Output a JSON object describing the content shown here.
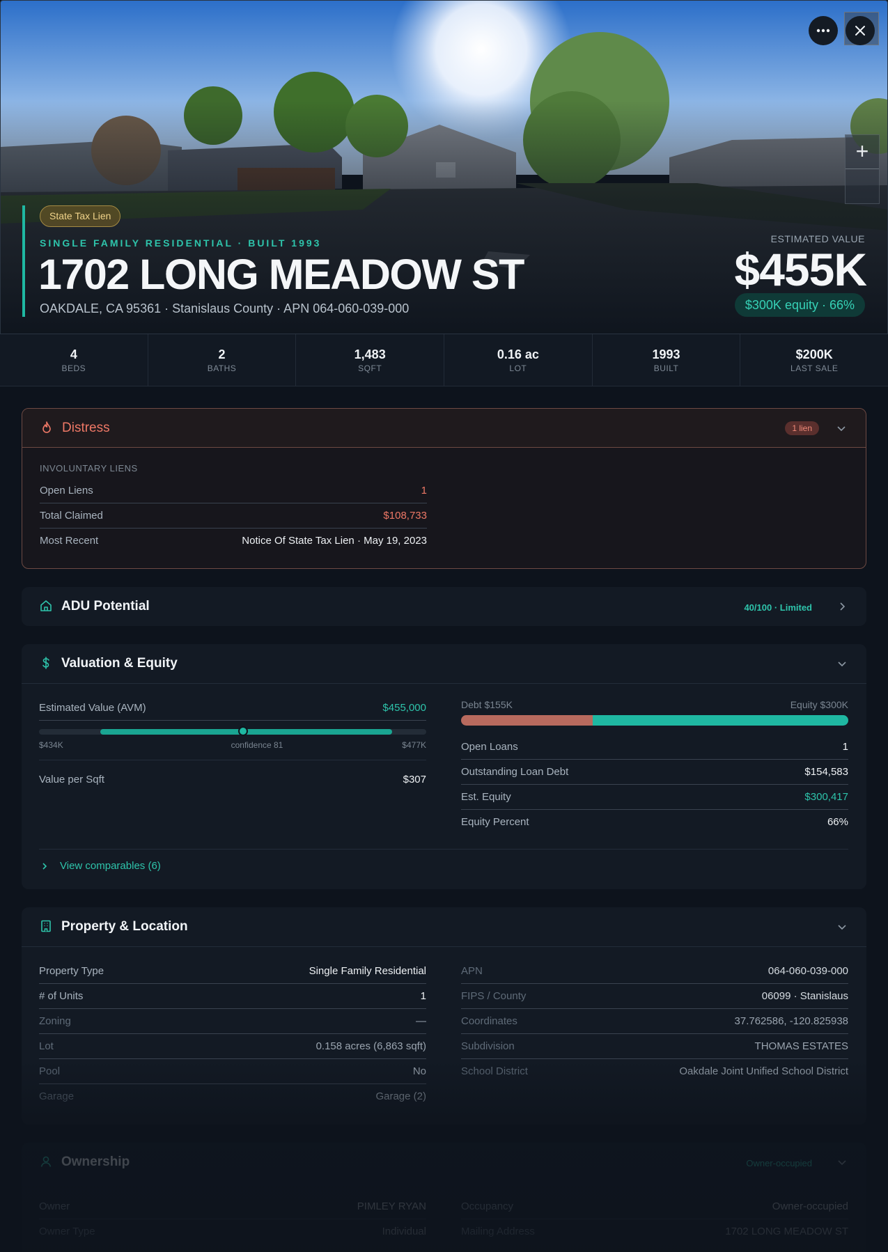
{
  "hero": {
    "lien_chip": "State Tax Lien",
    "subtype": "SINGLE FAMILY RESIDENTIAL · BUILT 1993",
    "address": "1702 LONG MEADOW ST",
    "location": "OAKDALE, CA 95361 · Stanislaus County · APN 064-060-039-000",
    "estimated_label": "ESTIMATED VALUE",
    "estimated_value": "$455K",
    "equity_chip": "$300K equity · 66%",
    "more_icon": "ellipsis-icon",
    "close_icon": "close-icon",
    "zoom_in": "+"
  },
  "stats": [
    {
      "value": "4",
      "label": "BEDS"
    },
    {
      "value": "2",
      "label": "BATHS"
    },
    {
      "value": "1,483",
      "label": "SQFT"
    },
    {
      "value": "0.16 ac",
      "label": "LOT"
    },
    {
      "value": "1993",
      "label": "BUILT"
    },
    {
      "value": "$200K",
      "label": "LAST SALE"
    }
  ],
  "distress": {
    "title": "Distress",
    "badge": "1 lien",
    "section": "INVOLUNTARY LIENS",
    "rows": [
      {
        "k": "Open Liens",
        "v": "1"
      },
      {
        "k": "Total Claimed",
        "v": "$108,733"
      },
      {
        "k": "Most Recent",
        "v": "Notice Of State Tax Lien · May 19, 2023"
      }
    ]
  },
  "adu": {
    "title": "ADU Potential",
    "badge": "40/100 · Limited"
  },
  "valuation": {
    "title": "Valuation & Equity",
    "avm_label": "Estimated Value (AVM)",
    "avm_value": "$455,000",
    "range_low": "$434K",
    "confidence": "confidence 81",
    "range_high": "$477K",
    "vps_label": "Value per Sqft",
    "vps_value": "$307",
    "debt_label": "Debt $155K",
    "equity_label": "Equity $300K",
    "debt_fraction": 0.34,
    "rows": [
      {
        "k": "Open Loans",
        "v": "1"
      },
      {
        "k": "Outstanding Loan Debt",
        "v": "$154,583"
      },
      {
        "k": "Est. Equity",
        "v": "$300,417"
      },
      {
        "k": "Equity Percent",
        "v": "66%"
      }
    ],
    "comparables": "View comparables (6)"
  },
  "property": {
    "title": "Property & Location",
    "left": [
      {
        "k": "Property Type",
        "v": "Single Family Residential"
      },
      {
        "k": "# of Units",
        "v": "1"
      },
      {
        "k": "Zoning",
        "v": "—"
      },
      {
        "k": "Lot",
        "v": "0.158 acres (6,863 sqft)"
      },
      {
        "k": "Pool",
        "v": "No"
      },
      {
        "k": "Garage",
        "v": "Garage (2)"
      }
    ],
    "right": [
      {
        "k": "APN",
        "v": "064-060-039-000"
      },
      {
        "k": "FIPS / County",
        "v": "06099 · Stanislaus"
      },
      {
        "k": "Coordinates",
        "v": "37.762586, -120.825938"
      },
      {
        "k": "Subdivision",
        "v": "THOMAS ESTATES"
      },
      {
        "k": "School District",
        "v": "Oakdale Joint Unified School District"
      }
    ]
  },
  "ownership": {
    "title": "Ownership",
    "badge": "Owner-occupied",
    "left": [
      {
        "k": "Owner",
        "v": "PIMLEY RYAN"
      },
      {
        "k": "Owner Type",
        "v": "Individual"
      }
    ],
    "right": [
      {
        "k": "Occupancy",
        "v": "Owner-occupied"
      },
      {
        "k": "Mailing Address",
        "v": "1702 LONG MEADOW ST"
      }
    ]
  }
}
